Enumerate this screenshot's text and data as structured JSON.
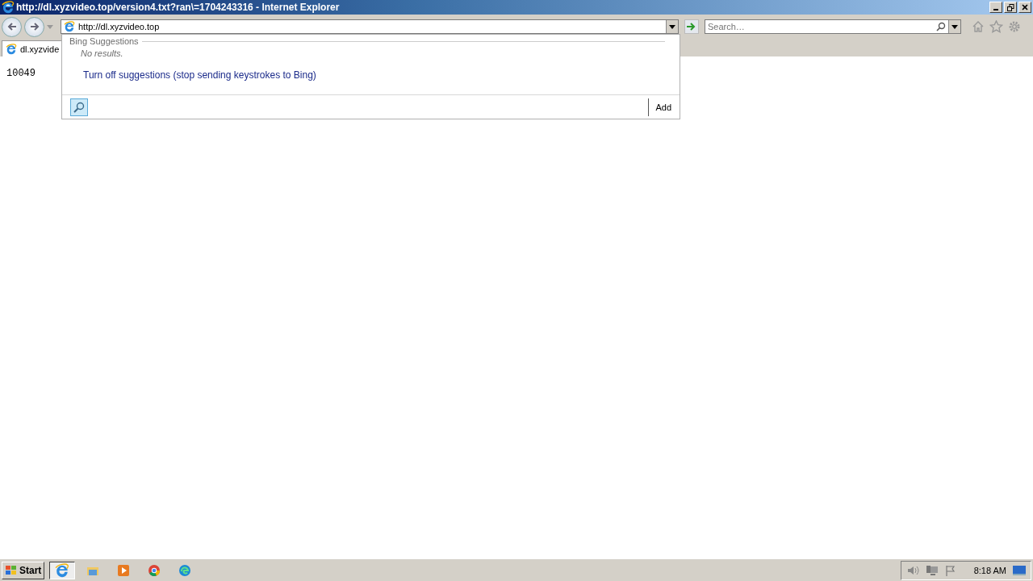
{
  "window": {
    "title": "http://dl.xyzvideo.top/version4.txt?ran\\=1704243316 - Internet Explorer"
  },
  "address_bar": {
    "value": "http://dl.xyzvideo.top"
  },
  "search": {
    "placeholder": "Search…"
  },
  "tabs": [
    {
      "label": "dl.xyzvide",
      "selected": true
    }
  ],
  "page": {
    "text": "10049"
  },
  "suggestions": {
    "heading": "Bing Suggestions",
    "empty_text": "No results.",
    "turn_off_link": "Turn off suggestions (stop sending keystrokes to Bing)",
    "add_button": "Add"
  },
  "taskbar": {
    "start": "Start",
    "apps": [
      {
        "kind": "ie",
        "selected": true
      },
      {
        "kind": "explorer",
        "selected": false
      },
      {
        "kind": "media",
        "selected": false
      },
      {
        "kind": "chrome",
        "selected": false
      },
      {
        "kind": "edge",
        "selected": false
      }
    ],
    "clock": "8:18 AM"
  }
}
